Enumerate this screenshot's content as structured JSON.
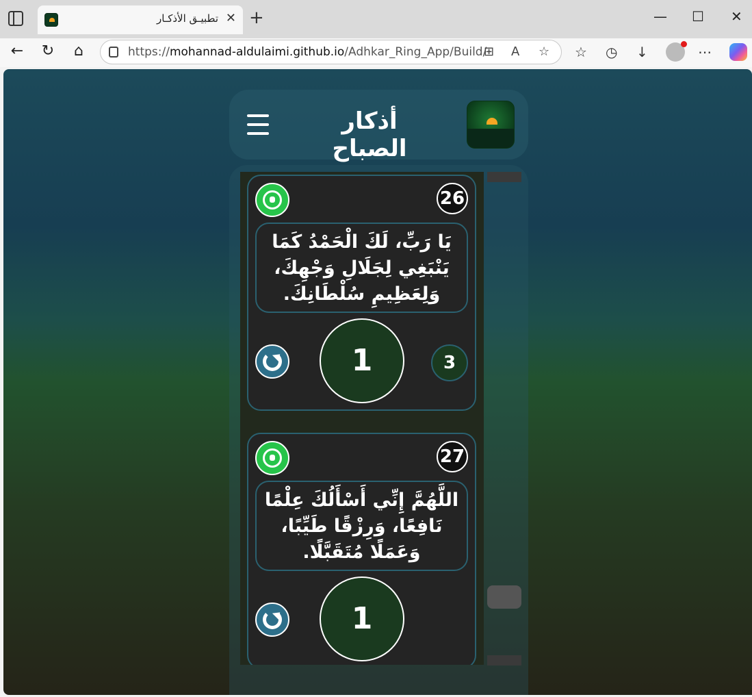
{
  "browser": {
    "tab_title": "تطبيـق الأذكـار",
    "url_prefix": "https://",
    "url_host": "mohannad-aldulaimi.github.io",
    "url_path": "/Adhkar_Ring_App/Build/"
  },
  "app": {
    "title": "أذكار الصباح"
  },
  "cards": [
    {
      "number": "26",
      "text": "يَا رَبِّ، لَكَ الْحَمْدُ كَمَا يَنْبَغِي لِجَلَالِ وَجْهِكَ، وَلِعَظِيمِ سُلْطَانِكَ.",
      "count": "1",
      "target": "3"
    },
    {
      "number": "27",
      "text": "اللَّهُمَّ إِنِّي أَسْأَلُكَ عِلْمًا نَافِعًا، وَرِزْقًا طَيِّبًا، وَعَمَلًا مُتَقَبَّلًا.",
      "count": "1"
    }
  ],
  "colors": {
    "whatsapp_green": "#27c44a",
    "card_border": "#2a6170",
    "counter_fill": "#1a3a1f"
  }
}
